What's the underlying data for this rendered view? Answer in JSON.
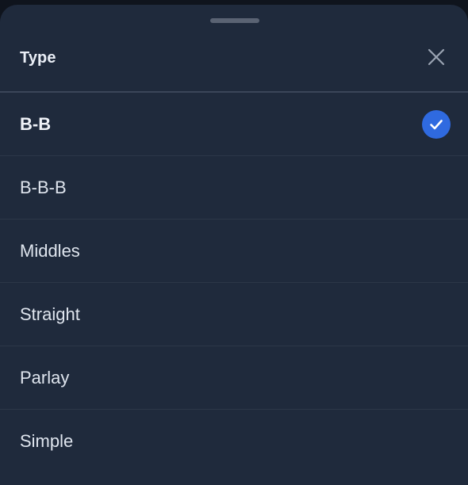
{
  "sheet": {
    "title": "Type",
    "close_icon": "close-icon",
    "check_icon": "checkmark-icon",
    "colors": {
      "background": "#1f2a3c",
      "accent": "#2f6ae0",
      "divider": "#3b4659"
    }
  },
  "options": [
    {
      "label": "B-B",
      "selected": true
    },
    {
      "label": "B-B-B",
      "selected": false
    },
    {
      "label": "Middles",
      "selected": false
    },
    {
      "label": "Straight",
      "selected": false
    },
    {
      "label": "Parlay",
      "selected": false
    },
    {
      "label": "Simple",
      "selected": false
    }
  ]
}
